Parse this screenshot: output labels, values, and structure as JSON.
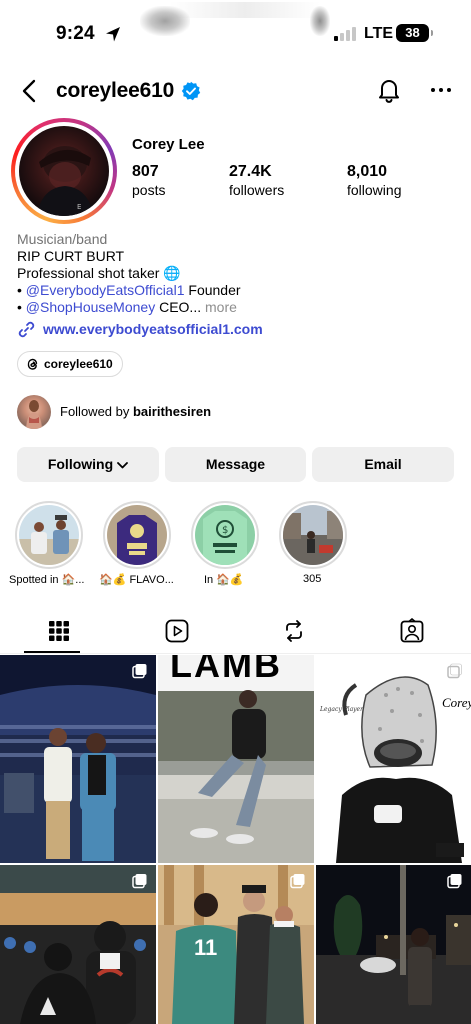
{
  "status_bar": {
    "time": "9:24",
    "network": "LTE",
    "battery": "38"
  },
  "header": {
    "username": "coreylee610"
  },
  "profile": {
    "display_name": "Corey Lee",
    "stats": [
      {
        "value": "807",
        "label": "posts"
      },
      {
        "value": "27.4K",
        "label": "followers"
      },
      {
        "value": "8,010",
        "label": "following"
      }
    ],
    "category": "Musician/band",
    "bio_line1": "RIP CURT BURT",
    "bio_line2": "Professional shot taker 🌐",
    "bio_line3_prefix": "• ",
    "bio_line3_mention": "@EverybodyEatsOfficial1",
    "bio_line3_suffix": " Founder",
    "bio_line4_prefix": "• ",
    "bio_line4_mention": "@ShopHouseMoney",
    "bio_line4_suffix": " CEO...",
    "bio_more": " more",
    "website": "www.everybodyeatsofficial1.com",
    "threads_handle": "coreylee610",
    "followed_by_prefix": "Followed by ",
    "followed_by_name": "bairithesiren"
  },
  "actions": {
    "following": "Following",
    "message": "Message",
    "email": "Email"
  },
  "highlights": [
    {
      "caption": "Spotted in 🏠..."
    },
    {
      "caption": "🏠💰 FLAVO..."
    },
    {
      "caption": "In 🏠💰"
    },
    {
      "caption": "305"
    }
  ],
  "grid_posts": [
    {
      "overlay_text": ""
    },
    {
      "overlay_text": "LAMB"
    },
    {
      "overlay_text": "Corey"
    },
    {
      "overlay_text": ""
    },
    {
      "overlay_text": "11"
    },
    {
      "overlay_text": ""
    }
  ],
  "colors": {
    "link_blue": "#3d4bd1",
    "verified_blue": "#0095f6",
    "button_grey": "#efefef"
  }
}
